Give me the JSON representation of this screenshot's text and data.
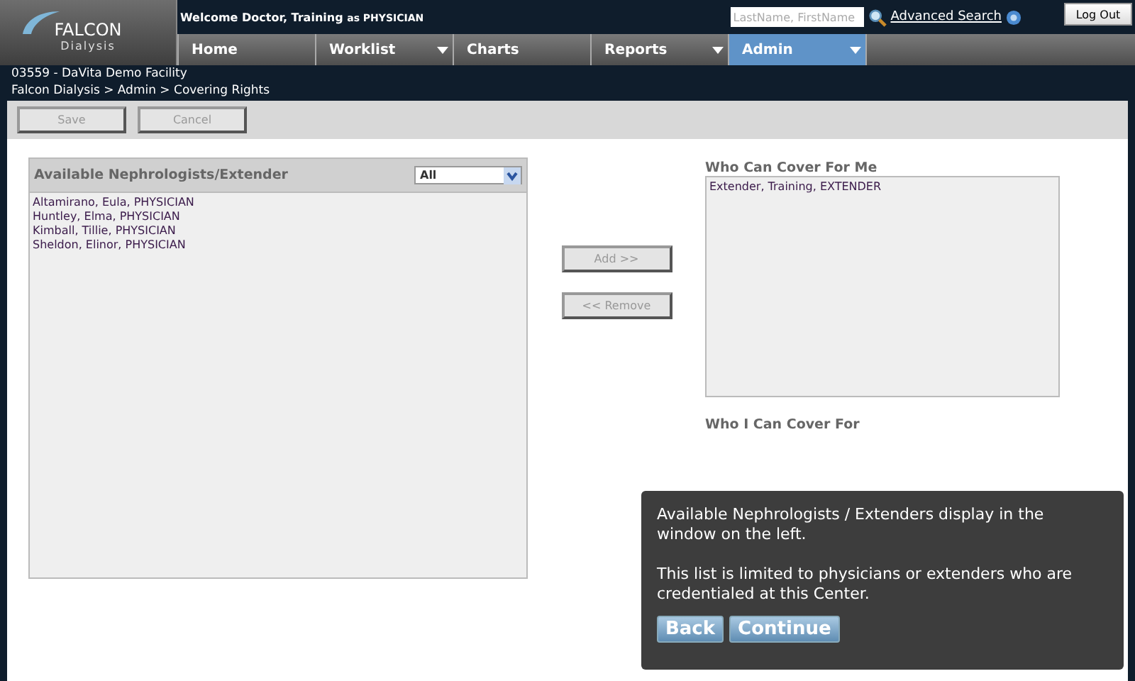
{
  "logo": {
    "name": "FALCON",
    "subtitle": "Dialysis"
  },
  "header": {
    "welcome": "Welcome Doctor, Training",
    "role_prefix": "as",
    "role": "PHYSICIAN",
    "search": {
      "placeholder": "LastName, FirstName"
    },
    "advanced_search": "Advanced Search",
    "logout": "Log Out"
  },
  "nav": [
    {
      "label": "Home",
      "selected": false,
      "has_menu": false
    },
    {
      "label": "Worklist",
      "selected": false,
      "has_menu": true
    },
    {
      "label": "Charts",
      "selected": false,
      "has_menu": false
    },
    {
      "label": "Reports",
      "selected": false,
      "has_menu": true
    },
    {
      "label": "Admin",
      "selected": true,
      "has_menu": true
    }
  ],
  "facility": "03559 - DaVita Demo Facility",
  "breadcrumb": "Falcon Dialysis > Admin > Covering Rights",
  "toolbar": [
    {
      "label": "Save",
      "disabled": true
    },
    {
      "label": "Cancel",
      "disabled": true
    }
  ],
  "available": {
    "title": "Available Nephrologists/Extender",
    "filter": "All",
    "items": [
      "Altamirano, Eula, PHYSICIAN",
      "Huntley, Elma, PHYSICIAN",
      "Kimball, Tillie, PHYSICIAN",
      "Sheldon, Elinor, PHYSICIAN"
    ]
  },
  "transfer_buttons": [
    {
      "label": "Add >>",
      "disabled": true
    },
    {
      "label": "<< Remove",
      "disabled": true
    }
  ],
  "cover_me": {
    "title": "Who Can Cover For Me",
    "items": [
      "Extender, Training, EXTENDER"
    ]
  },
  "cover_for": {
    "title": "Who I Can Cover For"
  },
  "tooltip": {
    "paragraphs": [
      "Available Nephrologists / Extenders display in the window on the left.",
      "This list is limited to physicians or extenders who are credentialed at this Center."
    ],
    "buttons": [
      "Back",
      "Continue"
    ]
  }
}
